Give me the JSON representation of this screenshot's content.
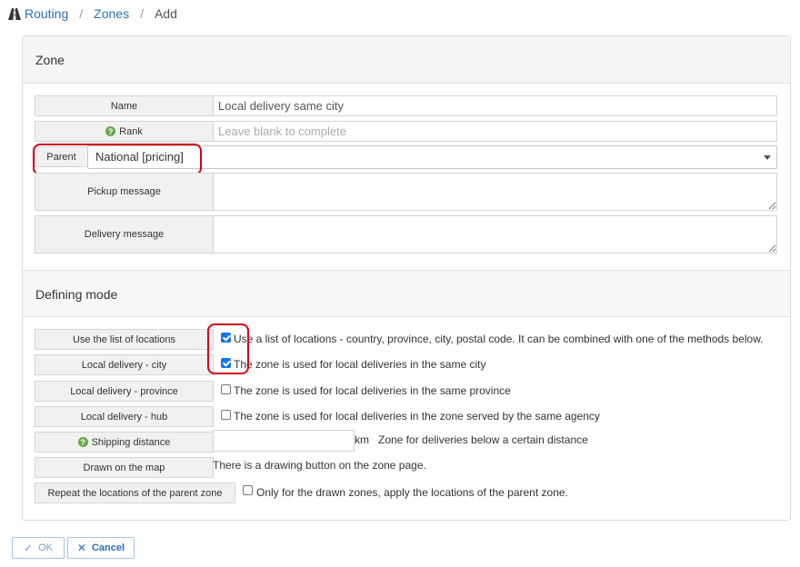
{
  "breadcrumb": {
    "items": [
      "Routing",
      "Zones"
    ],
    "current": "Add",
    "separator": "/"
  },
  "zone_section": {
    "title": "Zone",
    "name_label": "Name",
    "name_value": "Local delivery same city",
    "rank_label": "Rank",
    "rank_placeholder": "Leave blank to complete",
    "parent_label": "Parent",
    "parent_value": "National [pricing]",
    "pickup_label": "Pickup message",
    "delivery_label": "Delivery message"
  },
  "defining_mode": {
    "title": "Defining mode",
    "rows": [
      {
        "label": "Use the list of locations",
        "checked": true,
        "text": "Use a list of locations - country, province, city, postal code. It can be combined with one of the methods below."
      },
      {
        "label": "Local delivery - city",
        "checked": true,
        "text": "The zone is used for local deliveries in the same city"
      },
      {
        "label": "Local delivery - province",
        "checked": false,
        "text": "The zone is used for local deliveries in the same province"
      },
      {
        "label": "Local delivery - hub",
        "checked": false,
        "text": "The zone is used for local deliveries in the zone served by the same agency"
      }
    ],
    "shipping_label": "Shipping distance",
    "shipping_unit": "km",
    "shipping_text": "Zone for deliveries below a certain distance",
    "map_label": "Drawn on the map",
    "map_text": "There is a drawing button on the zone page.",
    "repeat_label": "Repeat the locations of the parent zone",
    "repeat_checked": false,
    "repeat_text": "Only for the drawn zones, apply the locations of the parent zone."
  },
  "buttons": {
    "ok": "OK",
    "cancel": "Cancel"
  },
  "colors": {
    "link": "#2a6fb5",
    "highlight": "#d0021b",
    "help_icon": "#6aa84f",
    "checkbox_checked": "#1a73e8"
  }
}
